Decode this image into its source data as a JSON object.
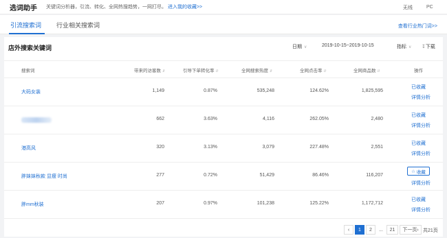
{
  "header": {
    "title": "选词助手",
    "tagline": "关键词分析器，引流、转化、全网热搜趋势，一网打尽。",
    "tagline_link": "进入我的收藏>>",
    "right_item_1": "无线",
    "right_item_2": "PC"
  },
  "tabs": [
    {
      "label": "引流搜索词",
      "active": true
    },
    {
      "label": "行业相关搜索词",
      "active": false
    }
  ],
  "industry_link": "查看行业热门词>>",
  "section": {
    "title": "店外搜索关键词",
    "date_label": "日期",
    "date_range": "2019-10-15~2019-10-15",
    "indicator_label": "指标",
    "download_label": "下载"
  },
  "table": {
    "headers": [
      "搜索词",
      "带来的访客数",
      "引导下单转化率",
      "全网搜索热度",
      "全网点击率",
      "全网商品数",
      "操作"
    ],
    "rows": [
      {
        "keyword": "大码女装",
        "visitors": "1,149",
        "conv": "0.87%",
        "heat": "535,248",
        "ctr": "124.62%",
        "items": "1,825,595",
        "fav": "已收藏",
        "detail": "详情分析"
      },
      {
        "keyword": "",
        "visitors": "662",
        "conv": "3.63%",
        "heat": "4,116",
        "ctr": "262.05%",
        "items": "2,480",
        "fav": "已收藏",
        "detail": "详情分析"
      },
      {
        "keyword": "港高风",
        "visitors": "320",
        "conv": "3.13%",
        "heat": "3,079",
        "ctr": "227.48%",
        "items": "2,551",
        "fav": "已收藏",
        "detail": "详情分析"
      },
      {
        "keyword": "胖妹妹秋款 显瘦 时尚",
        "visitors": "277",
        "conv": "0.72%",
        "heat": "51,429",
        "ctr": "86.46%",
        "items": "116,207",
        "fav": "收藏",
        "detail": "详情分析"
      },
      {
        "keyword": "胖mm秋装",
        "visitors": "207",
        "conv": "0.97%",
        "heat": "101,238",
        "ctr": "125.22%",
        "items": "1,172,712",
        "fav": "已收藏",
        "detail": "详情分析"
      }
    ]
  },
  "pagination": {
    "prev": "‹",
    "pages": [
      "1",
      "2",
      "...",
      "21"
    ],
    "next": "下一页›",
    "total": "共21页",
    "current": 1
  }
}
